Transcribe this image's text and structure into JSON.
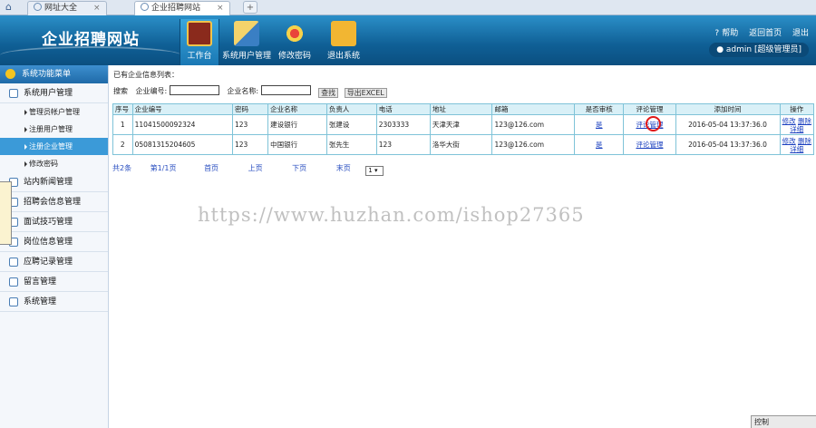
{
  "browser": {
    "tabs": [
      {
        "label": "网址大全",
        "active": false
      },
      {
        "label": "企业招聘网站",
        "active": true
      }
    ]
  },
  "header": {
    "site_title": "企业招聘网站",
    "nav": [
      {
        "label": "工作台",
        "icon": "book-icon",
        "active": true
      },
      {
        "label": "系统用户管理",
        "icon": "ruler-pencil-icon",
        "active": false
      },
      {
        "label": "修改密码",
        "icon": "compass-icon",
        "active": false
      },
      {
        "label": "退出系统",
        "icon": "folder-exit-icon",
        "active": false
      }
    ],
    "links": [
      "帮助",
      "返回首页",
      "退出"
    ],
    "user_badge": "admin [超级管理员]",
    "accent": "#0f5f95"
  },
  "sidebar": {
    "title": "系统功能菜单",
    "groups": [
      {
        "label": "系统用户管理",
        "items": [
          "管理员帐户管理",
          "注册用户管理",
          "注册企业管理",
          "修改密码"
        ],
        "active_item": "注册企业管理"
      },
      {
        "label": "站内新闻管理"
      },
      {
        "label": "招聘会信息管理"
      },
      {
        "label": "面试技巧管理"
      },
      {
        "label": "岗位信息管理"
      },
      {
        "label": "应聘记录管理"
      },
      {
        "label": "留言管理"
      },
      {
        "label": "系统管理"
      }
    ]
  },
  "main": {
    "list_title": "已有企业信息列表：",
    "search": {
      "prefix": "搜索",
      "field1_label": "企业编号:",
      "field2_label": "企业名称:",
      "search_button": "查找",
      "export_button": "导出EXCEL"
    },
    "table": {
      "headers": [
        "序号",
        "企业编号",
        "密码",
        "企业名称",
        "负责人",
        "电话",
        "地址",
        "邮箱",
        "是否审核",
        "评论管理",
        "添加时间",
        "操作"
      ],
      "rows": [
        [
          "1",
          "11041500092324",
          "123",
          "建设银行",
          "张建设",
          "2303333",
          "天津天津",
          "123@126.com",
          "是",
          "评论管理",
          "2016-05-04 13:37:36.0"
        ],
        [
          "2",
          "05081315204605",
          "123",
          "中国银行",
          "张先生",
          "123",
          "洛华大街",
          "123@126.com",
          "是",
          "评论管理",
          "2016-05-04 13:37:36.0"
        ]
      ],
      "row_actions": [
        "修改",
        "删除",
        "详细"
      ]
    },
    "pager": {
      "total": "共2条",
      "page_info": "第1/1页",
      "first": "首页",
      "prev": "上页",
      "next": "下页",
      "last": "末页",
      "select_value": "1"
    }
  },
  "watermark": "https://www.huzhan.com/ishop27365",
  "corner_label": "控制"
}
